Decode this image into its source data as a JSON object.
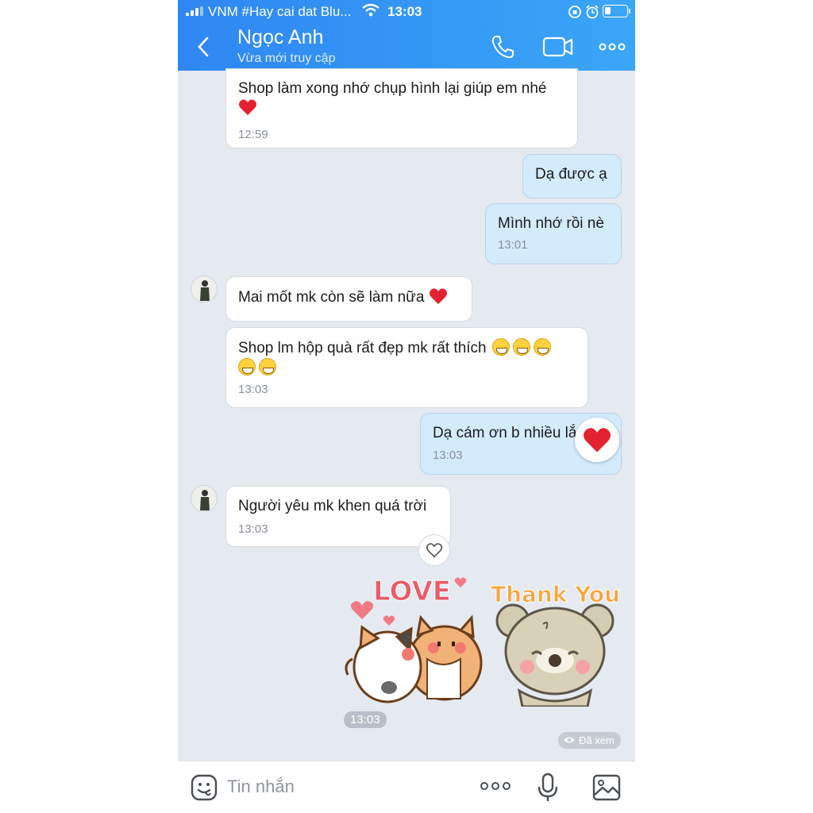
{
  "status_bar": {
    "carrier": "VNM #Hay cai dat Blu...",
    "time": "13:03"
  },
  "header": {
    "name": "Ngọc Anh",
    "status": "Vừa mới truy cập"
  },
  "messages": [
    {
      "text": "Shop làm xong nhớ chụp hình lại giúp em nhé",
      "time": "12:59"
    },
    {
      "text": "Dạ được ạ"
    },
    {
      "text": "Mình nhớ rồi nè",
      "time": "13:01"
    },
    {
      "text": "Mai mốt mk còn sẽ làm nữa"
    },
    {
      "text": "Shop lm hộp quà rất đẹp mk rất thích",
      "time": "13:03"
    },
    {
      "text": "Dạ cám ơn b nhiều lắ",
      "time": "13:03"
    },
    {
      "text": "Người yêu mk khen quá trời",
      "time": "13:03"
    }
  ],
  "stickers": {
    "love_text": "LOVE",
    "thanks_text": "Thank You!",
    "time": "13:03"
  },
  "seen_label": "Đã xem",
  "input": {
    "placeholder": "Tin nhắn"
  },
  "colors": {
    "header_start": "#2f86f2",
    "header_end": "#3aa6f8",
    "chat_bg": "#e5e9f0",
    "my_bubble": "#d4ebfc",
    "heart": "#e3222f"
  }
}
